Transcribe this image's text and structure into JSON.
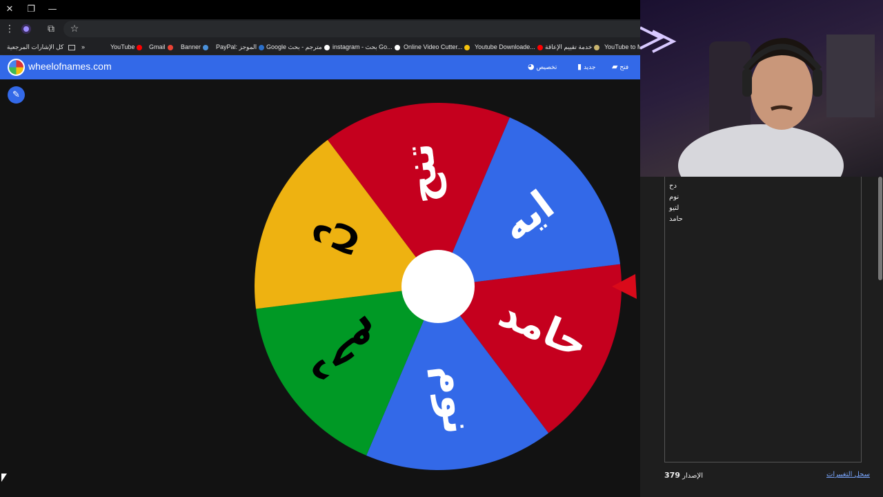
{
  "window": {
    "close_glyph": "✕",
    "restore_glyph": "❐",
    "minimize_glyph": "—"
  },
  "addressbar": {
    "menu_glyph": "⋮",
    "star_glyph": "☆",
    "ext_glyph": "⧉"
  },
  "bookmarks": {
    "all_bookmarks": "كل الإشارات المرجعية",
    "overflow": "»",
    "items": [
      {
        "label": "YouTube",
        "color": "#ff0000"
      },
      {
        "label": "Gmail",
        "color": "#ea4335"
      },
      {
        "label": "Banner",
        "color": "#4a90d9"
      },
      {
        "label": "PayPal: الموجز",
        "color": "#2b6fc9"
      },
      {
        "label": "Google مترجم - بحث",
        "color": "#ffffff"
      },
      {
        "label": "instagram - بحث Go...",
        "color": "#ffffff"
      },
      {
        "label": "Online Video Cutter...",
        "color": "#f4c20d"
      },
      {
        "label": "Youtube Downloade...",
        "color": "#ff0000"
      },
      {
        "label": "خدمة تقييم الإعاقة",
        "color": "#c8b46e"
      },
      {
        "label": "YouTube to Mi",
        "color": "#ff0000"
      }
    ]
  },
  "appbar": {
    "site": "wheelofnames.com",
    "customize": "تخصيص",
    "new": "جديد",
    "open": "فتح"
  },
  "wheel": {
    "segments": [
      {
        "label": "حامد",
        "color": "#c5001e",
        "text_color": "#ffffff"
      },
      {
        "label": "نوم",
        "color": "#3369e8",
        "text_color": "#ffffff"
      },
      {
        "label": "دحم",
        "color": "#009925",
        "text_color": "#000000"
      },
      {
        "label": "دح",
        "color": "#eeb211",
        "text_color": "#000000"
      },
      {
        "label": "تنح",
        "color": "#c5001e",
        "text_color": "#ffffff"
      },
      {
        "label": "ايه",
        "color": "#3369e8",
        "text_color": "#ffffff"
      }
    ],
    "pointer_color": "#d90a1a"
  },
  "sidebar": {
    "entries": [
      "دح",
      "نوم",
      "لتيو",
      "حامد"
    ],
    "version_label": "الإصدار",
    "version_number": "379",
    "changelog": "سجل التغييرات"
  }
}
